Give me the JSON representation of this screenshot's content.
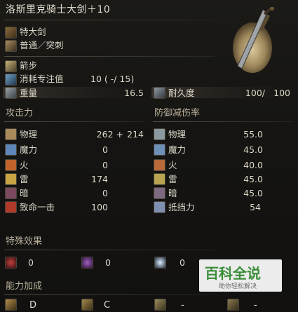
{
  "title": "洛斯里克骑士大剑＋10",
  "weapon_type": "特大剑",
  "attack_type": "普通／突刺",
  "skill": "箭步",
  "fp_cost": {
    "label": "消耗专注值",
    "value": "10 (  -/ 15)"
  },
  "weight": {
    "label": "重量",
    "value": "16.5"
  },
  "durability": {
    "label": "耐久度",
    "value": "100/",
    "max": "100"
  },
  "attack_header": "攻击力",
  "defense_header": "防御减伤率",
  "attack_rows": [
    {
      "label": "物理",
      "value": "262 +",
      "bonus": "214",
      "color": "#a98a5c"
    },
    {
      "label": "魔力",
      "value": "0",
      "color": "#5f86b8"
    },
    {
      "label": "火",
      "value": "0",
      "color": "#c0642c"
    },
    {
      "label": "雷",
      "value": "174",
      "color": "#c9a444"
    },
    {
      "label": "暗",
      "value": "0",
      "color": "#7c4a5e"
    },
    {
      "label": "致命一击",
      "value": "100",
      "color": "#b03a2a"
    }
  ],
  "defense_rows": [
    {
      "label": "物理",
      "value": "55.0",
      "color": "#8a9aa0"
    },
    {
      "label": "魔力",
      "value": "45.0",
      "color": "#6f90b6"
    },
    {
      "label": "火",
      "value": "40.0",
      "color": "#b86a3a"
    },
    {
      "label": "雷",
      "value": "45.0",
      "color": "#b8a450"
    },
    {
      "label": "暗",
      "value": "45.0",
      "color": "#7e6a80"
    },
    {
      "label": "抵挡力",
      "value": "54",
      "color": "#7f8fb0"
    }
  ],
  "special_header": "特殊效果",
  "effects": [
    {
      "value": "0",
      "color": "#8e2a2a"
    },
    {
      "value": "0",
      "color": "#7d3d8e"
    },
    {
      "value": "0",
      "color": "#9fb7d6"
    }
  ],
  "scaling_header": "能力加成",
  "scaling": [
    {
      "grade": "D",
      "color": "#b08a48"
    },
    {
      "grade": "C",
      "color": "#a0884c"
    },
    {
      "grade": "-",
      "color": "#9a8a5a"
    },
    {
      "grade": "-",
      "color": "#8a7a50"
    }
  ],
  "watermark": {
    "brand": "百科全说",
    "sub": "助你轻松解决"
  }
}
